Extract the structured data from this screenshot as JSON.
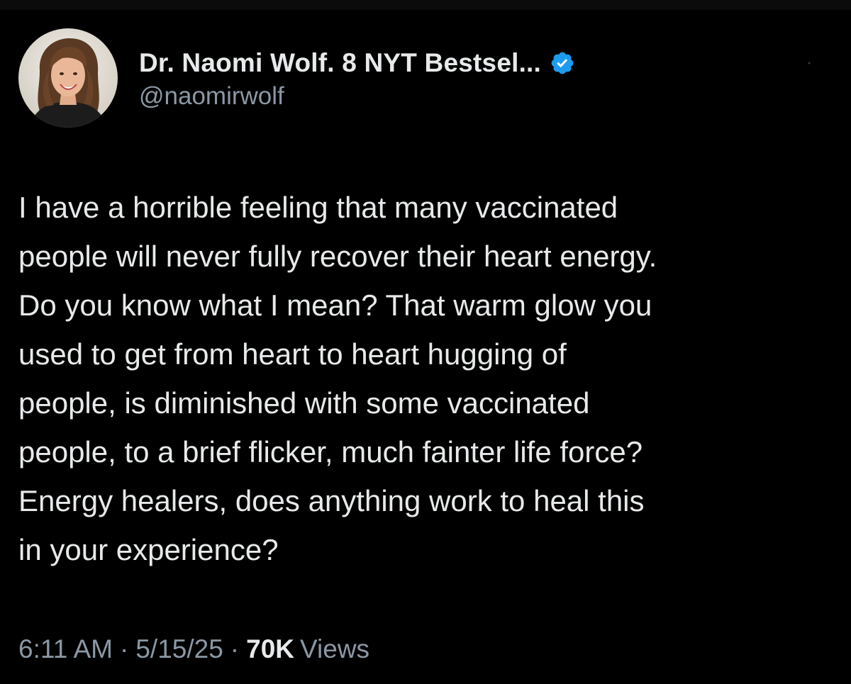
{
  "author": {
    "display_name": "Dr. Naomi Wolf. 8 NYT Bestsel...",
    "handle": "@naomirwolf",
    "verified": true,
    "avatar_icon": "profile-photo-woman",
    "badge_color": "#1d9bf0"
  },
  "post": {
    "text": "I have a horrible feeling that many vaccinated\npeople will never fully recover their heart energy.\nDo you know what I mean? That warm glow you\nused to get from heart to heart hugging of\npeople, is diminished with some vaccinated\npeople, to a brief flicker, much fainter life force?\nEnergy healers, does anything work to heal this\nin your experience?"
  },
  "meta": {
    "time": "6:11 AM",
    "separator": "·",
    "date": "5/15/25",
    "views_count": "70K",
    "views_label": "Views"
  },
  "colors": {
    "background": "#000000",
    "text_primary": "#e7e9ea",
    "text_secondary": "#8b98a5"
  }
}
